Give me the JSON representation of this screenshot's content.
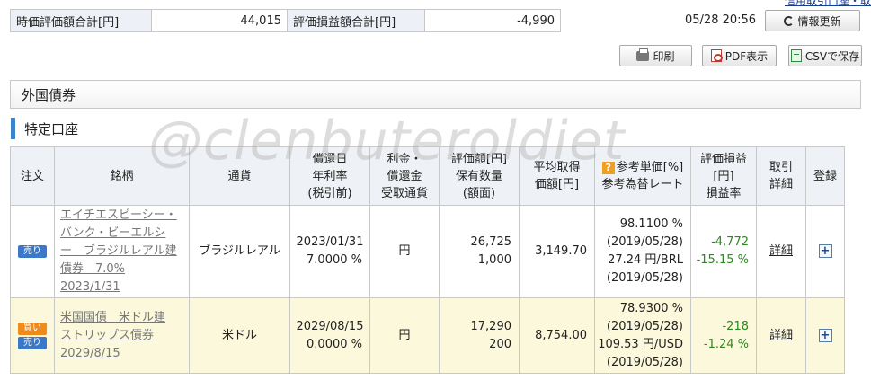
{
  "top_link": "信用取引口座・取扱",
  "summary": {
    "market_value_label": "時価評価額合計[円]",
    "market_value": "44,015",
    "pl_label": "評価損益額合計[円]",
    "pl_value": "-4,990"
  },
  "timestamp": "05/28 20:56",
  "buttons": {
    "refresh": "情報更新",
    "print": "印刷",
    "pdf": "PDF表示",
    "csv": "CSVで保存"
  },
  "section_title": "外国債券",
  "subsection_title": "特定口座",
  "watermark": "@clenbuteroldiet",
  "headers": {
    "order": "注文",
    "name": "銘柄",
    "currency": "通貨",
    "redemption_1": "償還日",
    "redemption_2": "年利率",
    "redemption_3": "(税引前)",
    "interest_1": "利金・",
    "interest_2": "償還金",
    "interest_3": "受取通貨",
    "value_1": "評価額[円]",
    "value_2": "保有数量",
    "value_3": "(額面)",
    "avg_1": "平均取得",
    "avg_2": "価額[円]",
    "ref_1": "参考単価[%]",
    "ref_2": "参考為替レート",
    "pl_1": "評価損益",
    "pl_2": "[円]",
    "pl_3": "損益率",
    "trade_1": "取引",
    "trade_2": "詳細",
    "register": "登録"
  },
  "rows": [
    {
      "tags": {
        "sell": "売り"
      },
      "name": [
        "エイチエスビーシー・",
        "バンク・ビーエルシ",
        "ー　ブラジルレアル建",
        "債券　7.0%",
        "2023/1/31"
      ],
      "currency": "ブラジルレアル",
      "redemption_date": "2023/01/31",
      "rate": "7.0000 %",
      "payout_currency": "円",
      "value": "26,725",
      "quantity": "1,000",
      "avg_price": "3,149.70",
      "ref_price": "98.1100 %",
      "ref_price_date": "(2019/05/28)",
      "fx_rate": "27.24 円/BRL",
      "fx_date": "(2019/05/28)",
      "pl": "-4,772",
      "pl_rate": "-15.15 %",
      "detail": "詳細",
      "plus": "+"
    },
    {
      "tags": {
        "buy": "買い",
        "sell": "売り"
      },
      "name": [
        "米国国債　米ドル建",
        "ストリップス債券",
        "2029/8/15"
      ],
      "currency": "米ドル",
      "redemption_date": "2029/08/15",
      "rate": "0.0000 %",
      "payout_currency": "円",
      "value": "17,290",
      "quantity": "200",
      "avg_price": "8,754.00",
      "ref_price": "78.9300 %",
      "ref_price_date": "(2019/05/28)",
      "fx_rate": "109.53 円/USD",
      "fx_date": "(2019/05/28)",
      "pl": "-218",
      "pl_rate": "-1.24 %",
      "detail": "詳細",
      "plus": "+"
    }
  ],
  "colors": {
    "header_bg": "#eef1f5",
    "buy_row_bg": "#fbf8dc",
    "accent_blue": "#3e82c9",
    "sell_tag": "#3c78c8",
    "buy_tag": "#f08a1a",
    "pl_green": "#2b8a1e"
  }
}
